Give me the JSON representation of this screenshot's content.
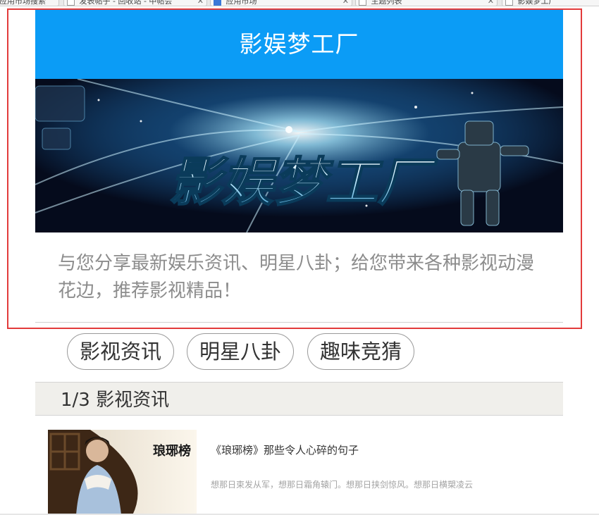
{
  "browser": {
    "tabs": [
      {
        "label": "应用市场搜索"
      },
      {
        "label": "发表帖子 - 回收站 - 中帖会"
      },
      {
        "label": "应用市场"
      },
      {
        "label": "主题列表"
      },
      {
        "label": "影娱梦工厂"
      }
    ]
  },
  "header": {
    "title": "影娱梦工厂"
  },
  "banner": {
    "logo_text": "影娱梦工厂"
  },
  "intro": {
    "text": "与您分享最新娱乐资讯、明星八卦；给您带来各种影视动漫花边，推荐影视精品！"
  },
  "nav": {
    "items": [
      {
        "label": "影视资讯"
      },
      {
        "label": "明星八卦"
      },
      {
        "label": "趣味竞猜"
      }
    ]
  },
  "section": {
    "title": "1/3 影视资讯"
  },
  "articles": [
    {
      "thumb_text": "琅琊榜",
      "title": "《琅琊榜》那些令人心碎的句子",
      "desc": "想那日束发从军，想那日霜角辕门。想那日挟剑惊风。想那日横槊凌云"
    }
  ],
  "colors": {
    "header_bg": "#0b9cf6",
    "highlight_frame": "#e23b3b",
    "section_bg": "#f0efeb"
  }
}
